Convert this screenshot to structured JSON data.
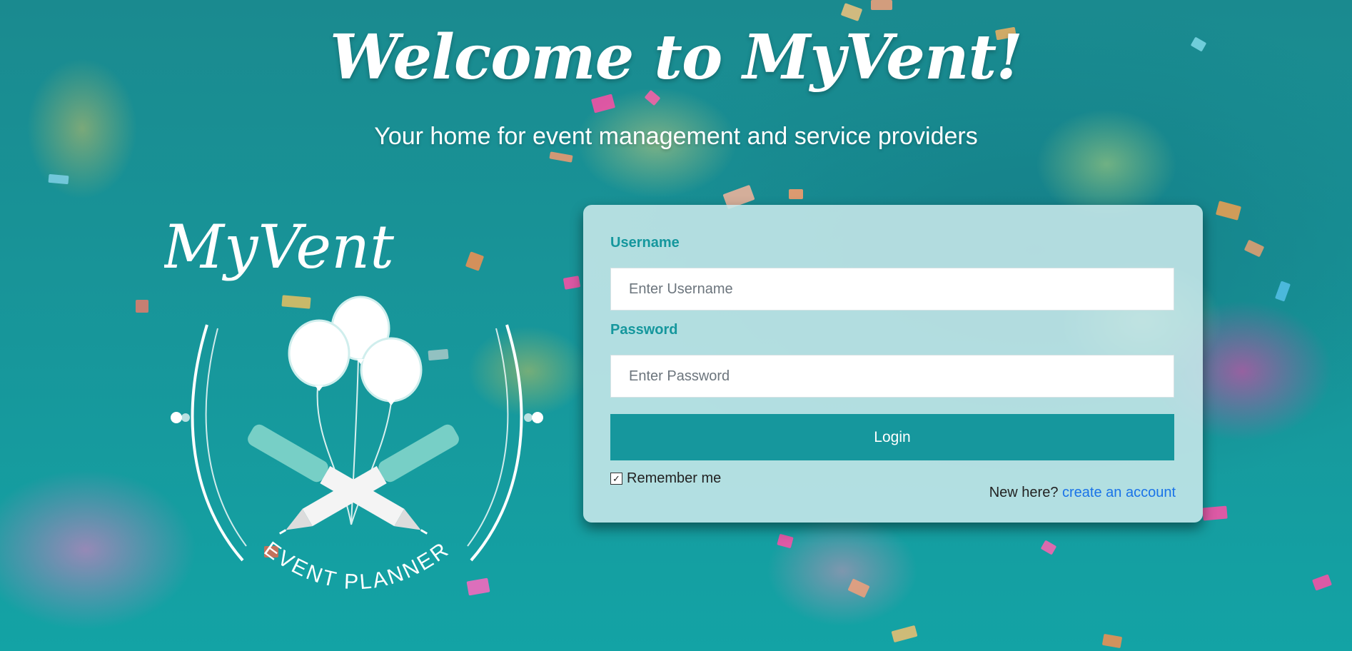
{
  "hero": {
    "title": "Welcome to MyVent!",
    "subtitle": "Your home for event management and service providers"
  },
  "logo": {
    "brand_text": "MyVent",
    "tagline": "EVENT PLANNER"
  },
  "login_form": {
    "username_label": "Username",
    "username_placeholder": "Enter Username",
    "username_value": "",
    "password_label": "Password",
    "password_placeholder": "Enter Password",
    "password_value": "",
    "login_button": "Login",
    "remember_me_label": "Remember me",
    "remember_me_checked": true,
    "new_here_text": "New here?",
    "create_account_link": "create an account"
  },
  "colors": {
    "background": "#17979b",
    "accent": "#16979d",
    "card_background": "#c8e8eb",
    "link": "#1a73e8"
  },
  "icons": [
    "checkbox-checked-icon",
    "balloon-icon",
    "pen-icon"
  ]
}
